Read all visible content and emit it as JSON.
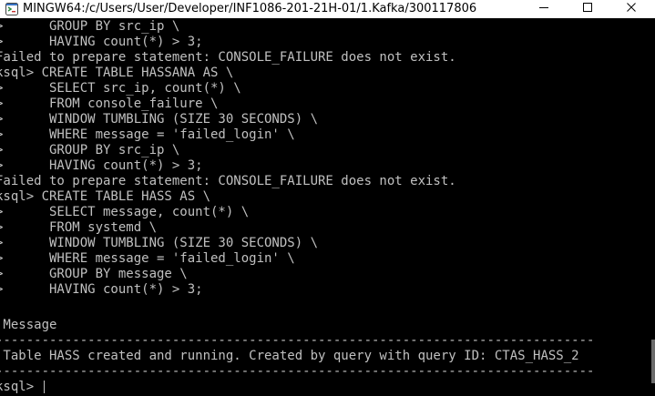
{
  "window": {
    "title": "MINGW64:/c/Users/User/Developer/INF1086-201-21H-01/1.Kafka/300117806",
    "icon": "terminal-app-icon",
    "buttons": {
      "minimize": "minimize-icon",
      "maximize": "maximize-icon",
      "close": "close-icon"
    }
  },
  "terminal": {
    "background": "#000000",
    "foreground": "#c0c0c0",
    "lines": [
      ">      GROUP BY src_ip \\",
      ">      HAVING count(*) > 3;",
      "Failed to prepare statement: CONSOLE_FAILURE does not exist.",
      "ksql> CREATE TABLE HASSANA AS \\",
      ">      SELECT src_ip, count(*) \\",
      ">      FROM console_failure \\",
      ">      WINDOW TUMBLING (SIZE 30 SECONDS) \\",
      ">      WHERE message = 'failed_login' \\",
      ">      GROUP BY src_ip \\",
      ">      HAVING count(*) > 3;",
      "Failed to prepare statement: CONSOLE_FAILURE does not exist.",
      "ksql> CREATE TABLE HASS AS \\",
      ">      SELECT message, count(*) \\",
      ">      FROM systemd \\",
      ">      WINDOW TUMBLING (SIZE 30 SECONDS) \\",
      ">      WHERE message = 'failed_login' \\",
      ">      GROUP BY message \\",
      ">      HAVING count(*) > 3;",
      "",
      " Message",
      "------------------------------------------------------------------------------",
      " Table HASS created and running. Created by query with query ID: CTAS_HASS_2",
      "------------------------------------------------------------------------------",
      "ksql> "
    ]
  }
}
